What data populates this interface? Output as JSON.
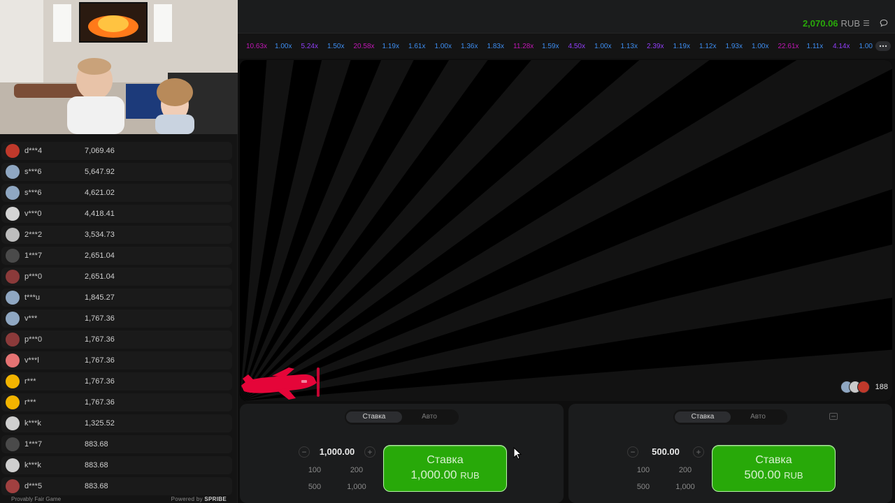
{
  "header": {
    "balance": "2,070.06",
    "currency": "RUB",
    "menu_icon": "hamburger-menu-icon",
    "chat_icon": "chat-bubble-icon"
  },
  "colors": {
    "accent_green": "#28a909",
    "mult_blue": "#3d8df0",
    "mult_purple": "#913ef8",
    "mult_pink": "#c017b4",
    "plane_red": "#e50539"
  },
  "multipliers": [
    {
      "value": "10.63x",
      "tone": "pink"
    },
    {
      "value": "1.00x",
      "tone": "blue"
    },
    {
      "value": "5.24x",
      "tone": "purple"
    },
    {
      "value": "1.50x",
      "tone": "blue"
    },
    {
      "value": "20.58x",
      "tone": "pink"
    },
    {
      "value": "1.19x",
      "tone": "blue"
    },
    {
      "value": "1.61x",
      "tone": "blue"
    },
    {
      "value": "1.00x",
      "tone": "blue"
    },
    {
      "value": "1.36x",
      "tone": "blue"
    },
    {
      "value": "1.83x",
      "tone": "blue"
    },
    {
      "value": "11.28x",
      "tone": "pink"
    },
    {
      "value": "1.59x",
      "tone": "blue"
    },
    {
      "value": "4.50x",
      "tone": "purple"
    },
    {
      "value": "1.00x",
      "tone": "blue"
    },
    {
      "value": "1.13x",
      "tone": "blue"
    },
    {
      "value": "2.39x",
      "tone": "purple"
    },
    {
      "value": "1.19x",
      "tone": "blue"
    },
    {
      "value": "1.12x",
      "tone": "blue"
    },
    {
      "value": "1.93x",
      "tone": "blue"
    },
    {
      "value": "1.00x",
      "tone": "blue"
    },
    {
      "value": "22.61x",
      "tone": "pink"
    },
    {
      "value": "1.11x",
      "tone": "blue"
    },
    {
      "value": "4.14x",
      "tone": "purple"
    },
    {
      "value": "1.00",
      "tone": "blue"
    }
  ],
  "bets_list": [
    {
      "user": "d***4",
      "amount": "7,069.46",
      "avatar_color": "#c0392b"
    },
    {
      "user": "s***6",
      "amount": "5,647.92",
      "avatar_color": "#8fa7c2"
    },
    {
      "user": "s***6",
      "amount": "4,621.02",
      "avatar_color": "#8fa7c2"
    },
    {
      "user": "v***0",
      "amount": "4,418.41",
      "avatar_color": "#d4d4d4"
    },
    {
      "user": "2***2",
      "amount": "3,534.73",
      "avatar_color": "#bdbdbd"
    },
    {
      "user": "1***7",
      "amount": "2,651.04",
      "avatar_color": "#4a4a4a"
    },
    {
      "user": "p***0",
      "amount": "2,651.04",
      "avatar_color": "#8b3a3a"
    },
    {
      "user": "t***u",
      "amount": "1,845.27",
      "avatar_color": "#8fa7c2"
    },
    {
      "user": "v***",
      "amount": "1,767.36",
      "avatar_color": "#8fa7c2"
    },
    {
      "user": "p***0",
      "amount": "1,767.36",
      "avatar_color": "#8b3a3a"
    },
    {
      "user": "v***l",
      "amount": "1,767.36",
      "avatar_color": "#e57373"
    },
    {
      "user": "r***",
      "amount": "1,767.36",
      "avatar_color": "#f2b400"
    },
    {
      "user": "r***",
      "amount": "1,767.36",
      "avatar_color": "#f2b400"
    },
    {
      "user": "k***k",
      "amount": "1,325.52",
      "avatar_color": "#cfcfcf"
    },
    {
      "user": "1***7",
      "amount": "883.68",
      "avatar_color": "#4a4a4a"
    },
    {
      "user": "k***k",
      "amount": "883.68",
      "avatar_color": "#cfcfcf"
    },
    {
      "user": "d***5",
      "amount": "883.68",
      "avatar_color": "#a04040"
    }
  ],
  "footer": {
    "provably_fair": "Provably Fair Game",
    "powered_by": "Powered by",
    "brand": "SPRIBE"
  },
  "game": {
    "players_count": "188"
  },
  "bet_panels": [
    {
      "tab_bet": "Ставка",
      "tab_auto": "Авто",
      "amount": "1,000.00",
      "quick": [
        "100",
        "200",
        "500",
        "1,000"
      ],
      "button_label": "Ставка",
      "button_amount": "1,000.00",
      "button_currency": "RUB",
      "minus": "−",
      "plus": "+"
    },
    {
      "tab_bet": "Ставка",
      "tab_auto": "Авто",
      "amount": "500.00",
      "quick": [
        "100",
        "200",
        "500",
        "1,000"
      ],
      "button_label": "Ставка",
      "button_amount": "500.00",
      "button_currency": "RUB",
      "minus": "−",
      "plus": "+"
    }
  ]
}
